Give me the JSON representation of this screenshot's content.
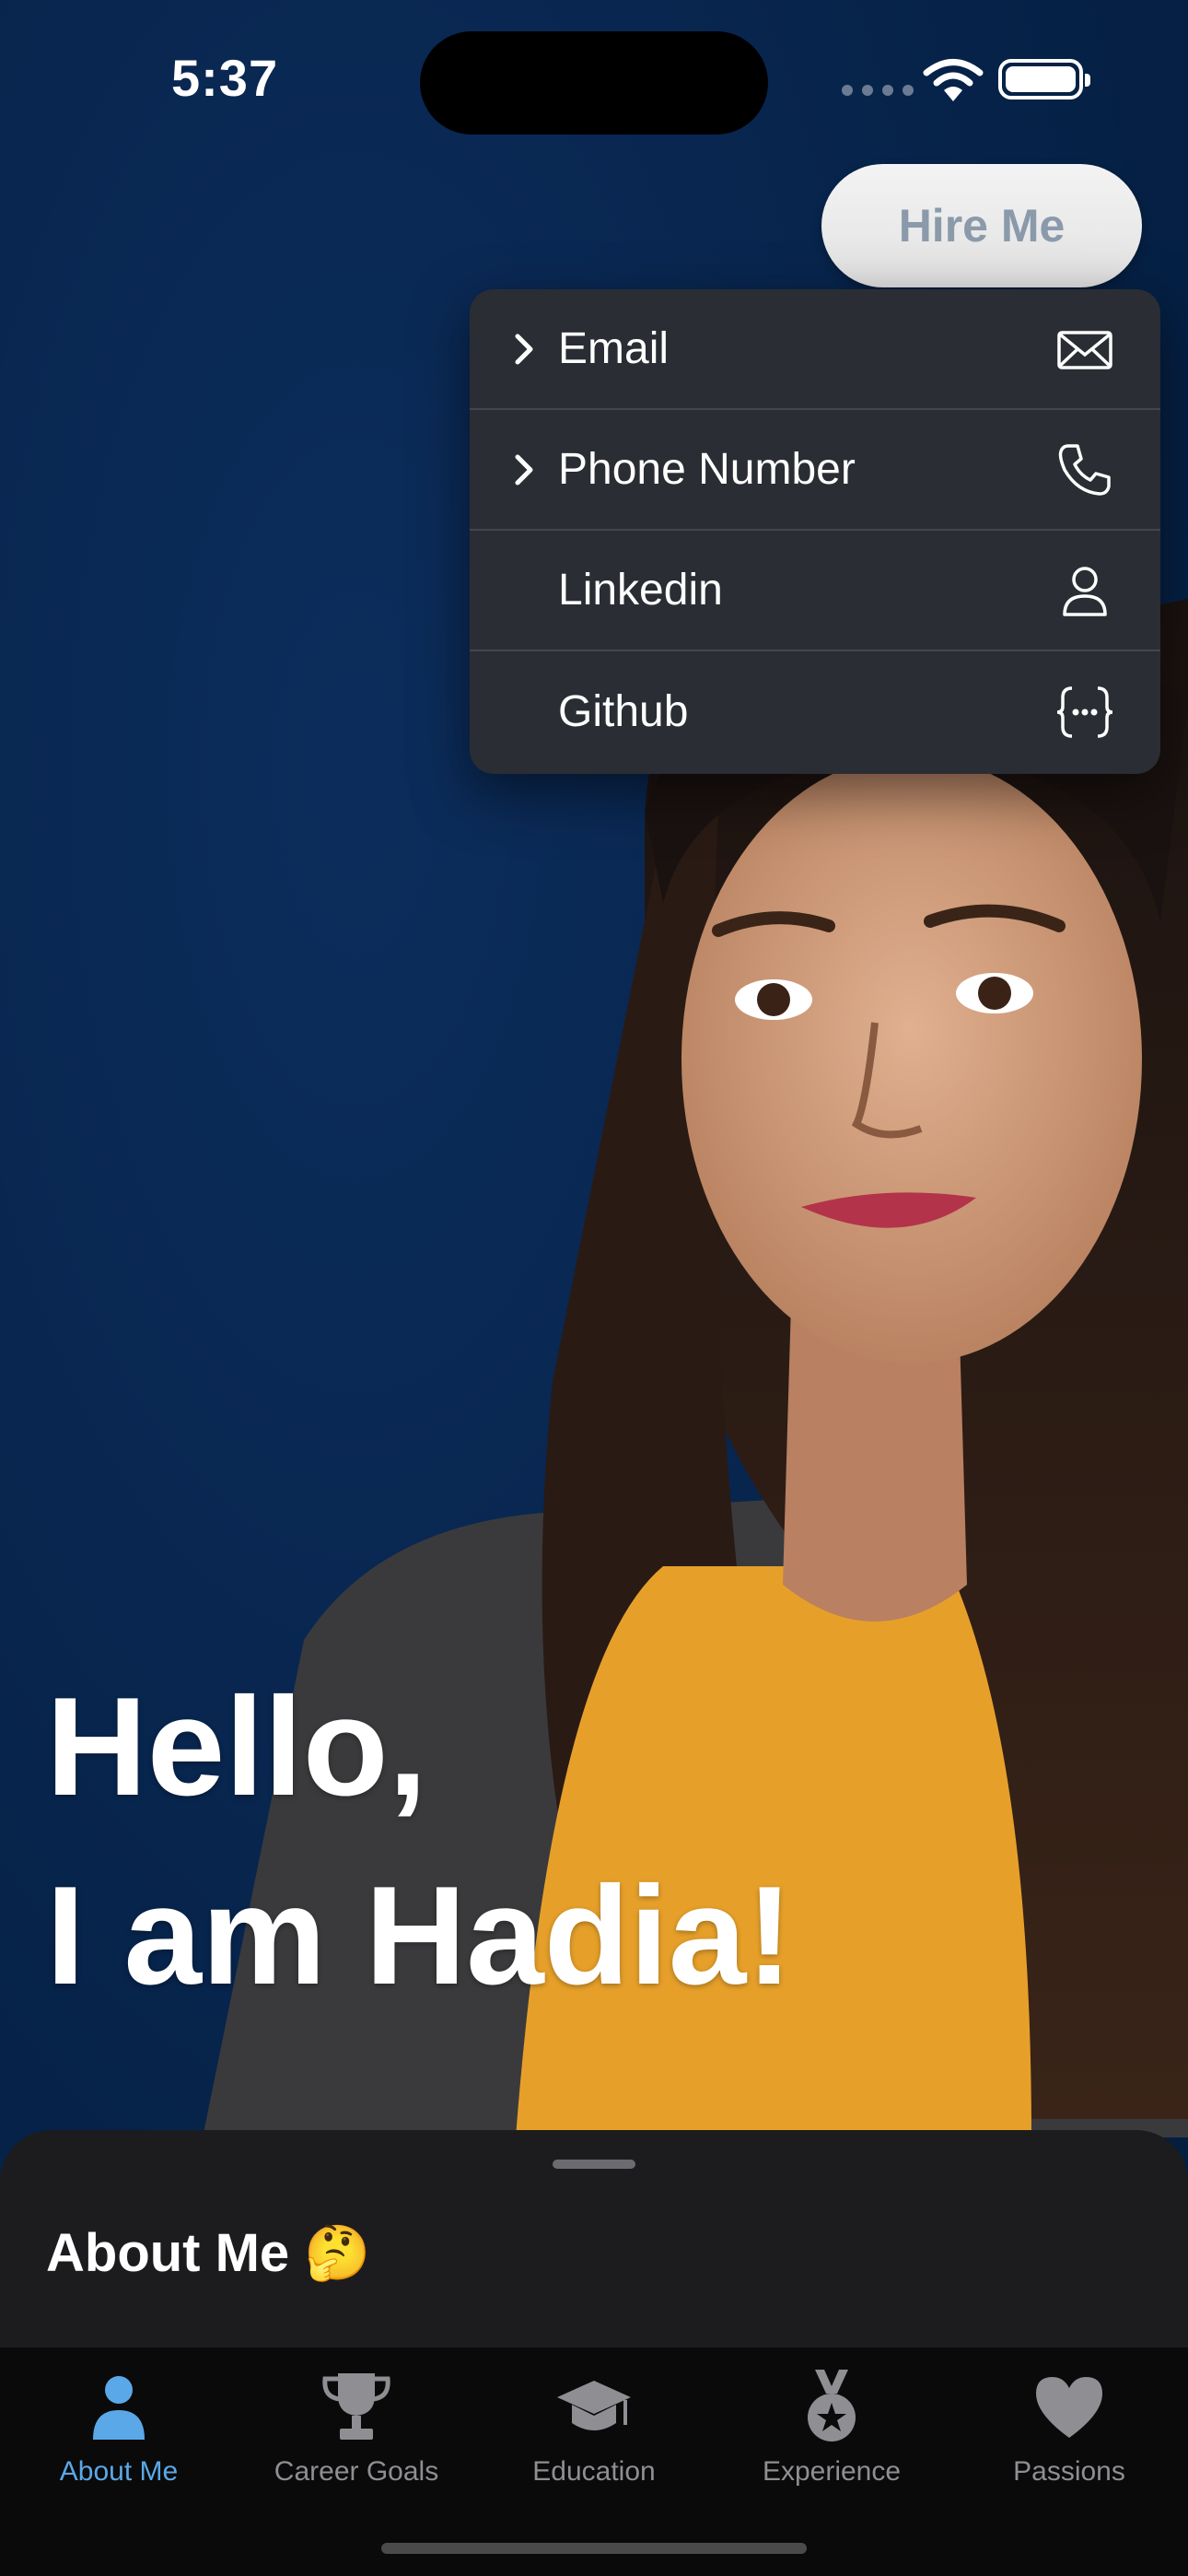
{
  "status_bar": {
    "time": "5:37"
  },
  "header": {
    "hire_button_label": "Hire Me"
  },
  "menu": {
    "items": [
      {
        "label": "Email",
        "icon": "envelope-icon",
        "has_chevron": true
      },
      {
        "label": "Phone Number",
        "icon": "phone-icon",
        "has_chevron": true
      },
      {
        "label": "Linkedin",
        "icon": "person-icon",
        "has_chevron": false
      },
      {
        "label": "Github",
        "icon": "curly-braces-icon",
        "has_chevron": false
      }
    ]
  },
  "hero": {
    "line1": "Hello,",
    "line2": "I am Hadia!"
  },
  "sheet": {
    "title": "About Me 🤔"
  },
  "tabs": [
    {
      "label": "About Me",
      "icon": "person-icon",
      "active": true
    },
    {
      "label": "Career Goals",
      "icon": "trophy-icon",
      "active": false
    },
    {
      "label": "Education",
      "icon": "graduation-cap-icon",
      "active": false
    },
    {
      "label": "Experience",
      "icon": "medal-icon",
      "active": false
    },
    {
      "label": "Passions",
      "icon": "heart-icon",
      "active": false
    }
  ],
  "colors": {
    "accent": "#5aa8e8",
    "background": "#062248",
    "sweater": "#e6a02a"
  }
}
